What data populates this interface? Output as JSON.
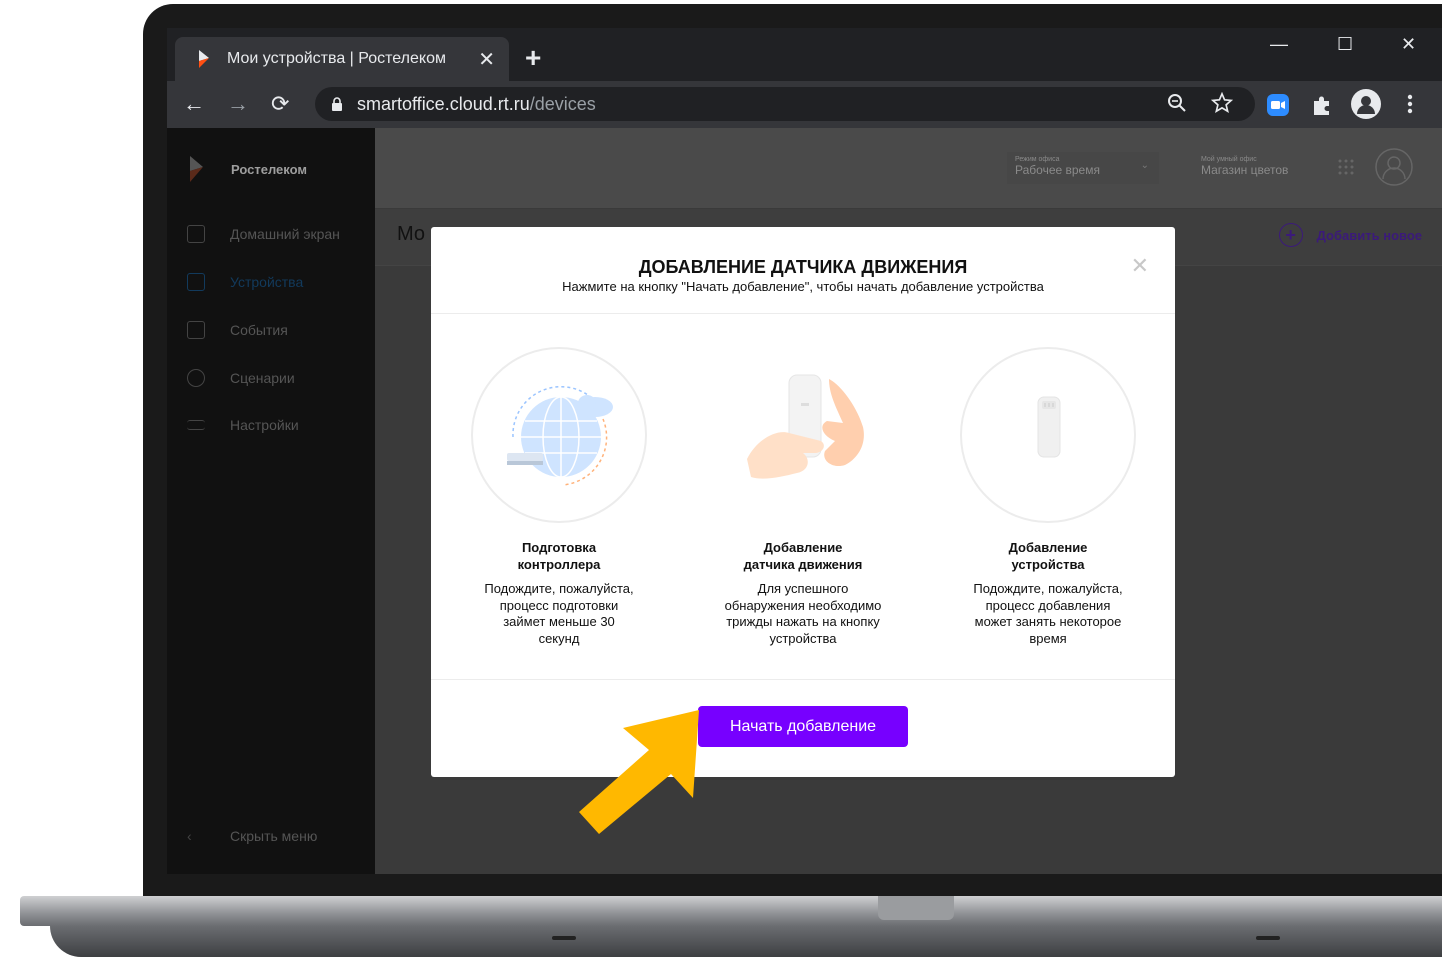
{
  "browser": {
    "tab_title": "Мои устройства | Ростелеком",
    "tab_close": "✕",
    "new_tab": "+",
    "window_controls": {
      "minimize": "—",
      "maximize": "☐",
      "close": "✕"
    },
    "url_host": "smartoffice.cloud.rt.ru",
    "url_path": "/devices",
    "nav": {
      "back": "←",
      "forward": "→",
      "reload": "⟳"
    },
    "icons": [
      "zoom-icon",
      "star-icon",
      "zoom-extension-icon",
      "puzzle-icon",
      "profile-icon",
      "menu-icon"
    ]
  },
  "sidebar": {
    "brand": "Ростелеком",
    "items": [
      {
        "label": "Домашний экран",
        "icon": "grid-icon"
      },
      {
        "label": "Устройства",
        "icon": "device-icon",
        "active": true
      },
      {
        "label": "События",
        "icon": "calendar-icon"
      },
      {
        "label": "Сценарии",
        "icon": "scenario-icon"
      },
      {
        "label": "Настройки",
        "icon": "sliders-icon"
      }
    ],
    "collapse": "Скрыть меню"
  },
  "header": {
    "mode_label": "Режим офиса",
    "mode_value": "Рабочее время",
    "office_label": "Мой умный офис",
    "office_value": "Магазин цветов"
  },
  "subbar": {
    "page_title_partial": "Мо",
    "add_new": "Добавить новое"
  },
  "modal": {
    "title": "ДОБАВЛЕНИЕ ДАТЧИКА ДВИЖЕНИЯ",
    "subtitle": "Нажмите на кнопку \"Начать добавление\", чтобы начать добавление устройства",
    "close": "✕",
    "steps": [
      {
        "title_line1": "Подготовка",
        "title_line2": "контроллера",
        "desc": [
          "Подождите, пожалуйста,",
          "процесс подготовки",
          "займет меньше 30",
          "секунд"
        ]
      },
      {
        "title_line1": "Добавление",
        "title_line2": "датчика движения",
        "desc": [
          "Для успешного",
          "обнаружения необходимо",
          "трижды нажать на кнопку",
          "устройства"
        ]
      },
      {
        "title_line1": "Добавление",
        "title_line2": "устройства",
        "desc": [
          "Подождите, пожалуйста,",
          "процесс добавления",
          "может занять некоторое",
          "время"
        ]
      }
    ],
    "start_button": "Начать добавление"
  },
  "colors": {
    "accent": "#7700ff",
    "arrow": "#ffb800",
    "overlay": "#3a3a3a"
  }
}
